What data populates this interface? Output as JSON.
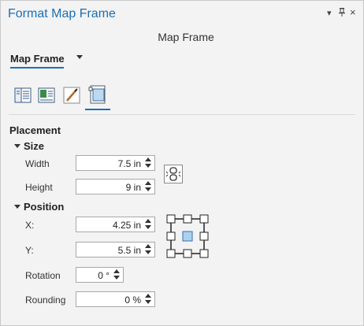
{
  "window": {
    "title": "Format Map Frame",
    "subtitle": "Map Frame",
    "controls": [
      "chevron-down-icon",
      "pin-icon",
      "close-icon"
    ]
  },
  "element_dropdown": {
    "selected": "Map Frame"
  },
  "tabs": [
    "options-icon",
    "display-icon",
    "symbol-icon",
    "placement-icon"
  ],
  "placement": {
    "title": "Placement",
    "size": {
      "title": "Size",
      "width_label": "Width",
      "width_value": "7.5 in",
      "height_label": "Height",
      "height_value": "9 in"
    },
    "position": {
      "title": "Position",
      "x_label": "X:",
      "x_value": "4.25 in",
      "y_label": "Y:",
      "y_value": "5.5 in",
      "rotation_label": "Rotation",
      "rotation_value": "0 °",
      "rounding_label": "Rounding",
      "rounding_value": "0 %"
    }
  },
  "colors": {
    "accent": "#1b6fb5",
    "anchor_fill": "#a9d2f2"
  }
}
